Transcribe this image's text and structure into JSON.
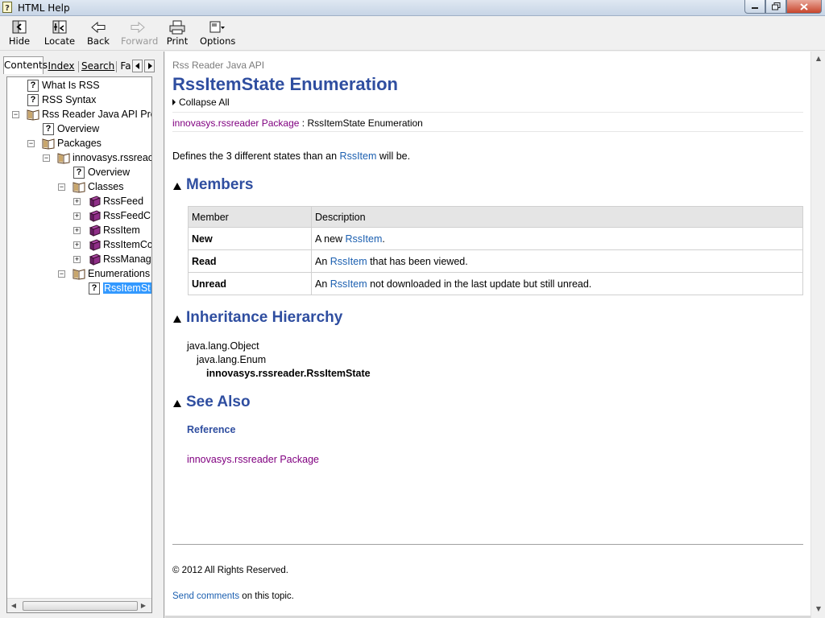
{
  "window": {
    "title": "HTML Help",
    "controls": [
      "minimize",
      "maximize",
      "close"
    ]
  },
  "toolbar": {
    "buttons": [
      {
        "label": "Hide",
        "icon": "hide-pane-icon",
        "enabled": true
      },
      {
        "label": "Locate",
        "icon": "locate-icon",
        "enabled": true
      },
      {
        "label": "Back",
        "icon": "back-arrow-icon",
        "enabled": true
      },
      {
        "label": "Forward",
        "icon": "forward-arrow-icon",
        "enabled": false
      },
      {
        "label": "Print",
        "icon": "printer-icon",
        "enabled": true
      },
      {
        "label": "Options",
        "icon": "options-icon",
        "enabled": true
      }
    ]
  },
  "nav": {
    "tabs": [
      {
        "label": "Contents",
        "active": true
      },
      {
        "label": "Index",
        "active": false
      },
      {
        "label": "Search",
        "active": false
      },
      {
        "label": "Fa",
        "active": false
      }
    ],
    "tree": [
      {
        "label": "What Is RSS",
        "icon": "help-page-icon",
        "level": 0
      },
      {
        "label": "RSS Syntax",
        "icon": "help-page-icon",
        "level": 0
      },
      {
        "label": "Rss Reader Java API Pro",
        "icon": "open-book-icon",
        "level": 0,
        "expanded": true
      },
      {
        "label": "Overview",
        "icon": "help-page-icon",
        "level": 1
      },
      {
        "label": "Packages",
        "icon": "open-book-icon",
        "level": 1,
        "expanded": true
      },
      {
        "label": "innovasys.rssreac",
        "icon": "open-book-icon",
        "level": 2,
        "expanded": true
      },
      {
        "label": "Overview",
        "icon": "help-page-icon",
        "level": 3
      },
      {
        "label": "Classes",
        "icon": "open-book-icon",
        "level": 3,
        "expanded": true
      },
      {
        "label": "RssFeed",
        "icon": "closed-book-icon",
        "level": 4,
        "expanded": false
      },
      {
        "label": "RssFeedC",
        "icon": "closed-book-icon",
        "level": 4,
        "expanded": false
      },
      {
        "label": "RssItem",
        "icon": "closed-book-icon",
        "level": 4,
        "expanded": false
      },
      {
        "label": "RssItemCc",
        "icon": "closed-book-icon",
        "level": 4,
        "expanded": false
      },
      {
        "label": "RssManag",
        "icon": "closed-book-icon",
        "level": 4,
        "expanded": false
      },
      {
        "label": "Enumerations",
        "icon": "open-book-icon",
        "level": 3,
        "expanded": true
      },
      {
        "label": "RssItemSt",
        "icon": "help-page-icon",
        "level": 4,
        "selected": true
      }
    ]
  },
  "content": {
    "breadcrumb": "Rss Reader Java API",
    "title": "RssItemState Enumeration",
    "collapse_all": "Collapse All",
    "path": {
      "package_link": "innovasys.rssreader Package",
      "separator": " : ",
      "current": "RssItemState Enumeration"
    },
    "description": {
      "before": "Defines the 3 different states than an ",
      "link": "RssItem",
      "after": " will be."
    },
    "members": {
      "heading": "Members",
      "columns": [
        "Member",
        "Description"
      ],
      "rows": [
        {
          "name": "New",
          "desc_before": "A new ",
          "desc_link": "RssItem",
          "desc_after": "."
        },
        {
          "name": "Read",
          "desc_before": "An ",
          "desc_link": "RssItem",
          "desc_after": " that has been viewed."
        },
        {
          "name": "Unread",
          "desc_before": "An ",
          "desc_link": "RssItem",
          "desc_after": " not downloaded in the last update but still unread."
        }
      ]
    },
    "inheritance": {
      "heading": "Inheritance Hierarchy",
      "lines": [
        "java.lang.Object",
        "java.lang.Enum",
        "innovasys.rssreader.RssItemState"
      ]
    },
    "see_also": {
      "heading": "See Also",
      "reference_heading": "Reference",
      "link": "innovasys.rssreader Package"
    },
    "footer": {
      "copyright": "© 2012 All Rights Reserved.",
      "send_link": "Send comments",
      "send_after": " on this topic."
    }
  },
  "colors": {
    "heading": "#2f4ea0",
    "link": "#1b5fb0",
    "visited_link": "#800080",
    "selection": "#3399ff"
  }
}
